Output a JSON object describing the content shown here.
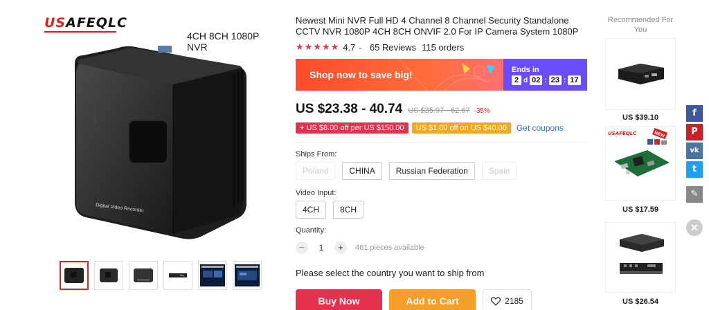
{
  "brand": {
    "logo_text": "USAFEQLC"
  },
  "gallery": {
    "caption": "4CH 8CH 1080P NVR",
    "device_label": "Digital Video Recorder"
  },
  "product": {
    "title": "Newest Mini NVR Full HD 4 Channel 8 Channel Security Standalone CCTV NVR 1080P 4CH 8CH ONVIF 2.0 For IP Camera System 1080P",
    "rating": "4.7",
    "reviews": "65 Reviews",
    "orders": "115 orders",
    "stars": 5
  },
  "banner": {
    "text": "Shop now to save big!",
    "ends_label": "Ends in",
    "days": "2",
    "days_unit": "d",
    "hours": "02",
    "minutes": "23",
    "seconds": "17"
  },
  "price": {
    "current": "US $23.38 - 40.74",
    "original": "US $35.97 - 62.67",
    "discount": "-35%"
  },
  "coupons": {
    "first": "US $8.00 off per US $150.00",
    "second": "US $1.00 off on US $40.00",
    "get_label": "Get coupons"
  },
  "ships_from": {
    "label": "Ships From:",
    "options": [
      "Poland",
      "CHINA",
      "Russian Federation",
      "Spain"
    ]
  },
  "video_input": {
    "label": "Video Input:",
    "options": [
      "4CH",
      "8CH"
    ]
  },
  "quantity": {
    "label": "Quantity:",
    "minus": "−",
    "value": "1",
    "plus": "+",
    "available": "461 pieces available"
  },
  "ship_note": "Please select the country you want to ship from",
  "actions": {
    "buy": "Buy Now",
    "cart": "Add to Cart",
    "wishlist_count": "2185"
  },
  "recommended": {
    "title": "Recommended For You",
    "items": [
      {
        "price": "US $39.10"
      },
      {
        "price": "US $17.59",
        "logo": "USAFEQLC",
        "badge": "NEW"
      },
      {
        "price": "US $26.54"
      }
    ]
  },
  "social": {
    "facebook": "f",
    "pinterest": "P",
    "vk": "vk",
    "twitter": "t",
    "edit": "✎",
    "close": "✕"
  },
  "colors": {
    "accent_red": "#e3314e",
    "orange": "#f59e2a",
    "banner_purple": "#6b4cff"
  }
}
